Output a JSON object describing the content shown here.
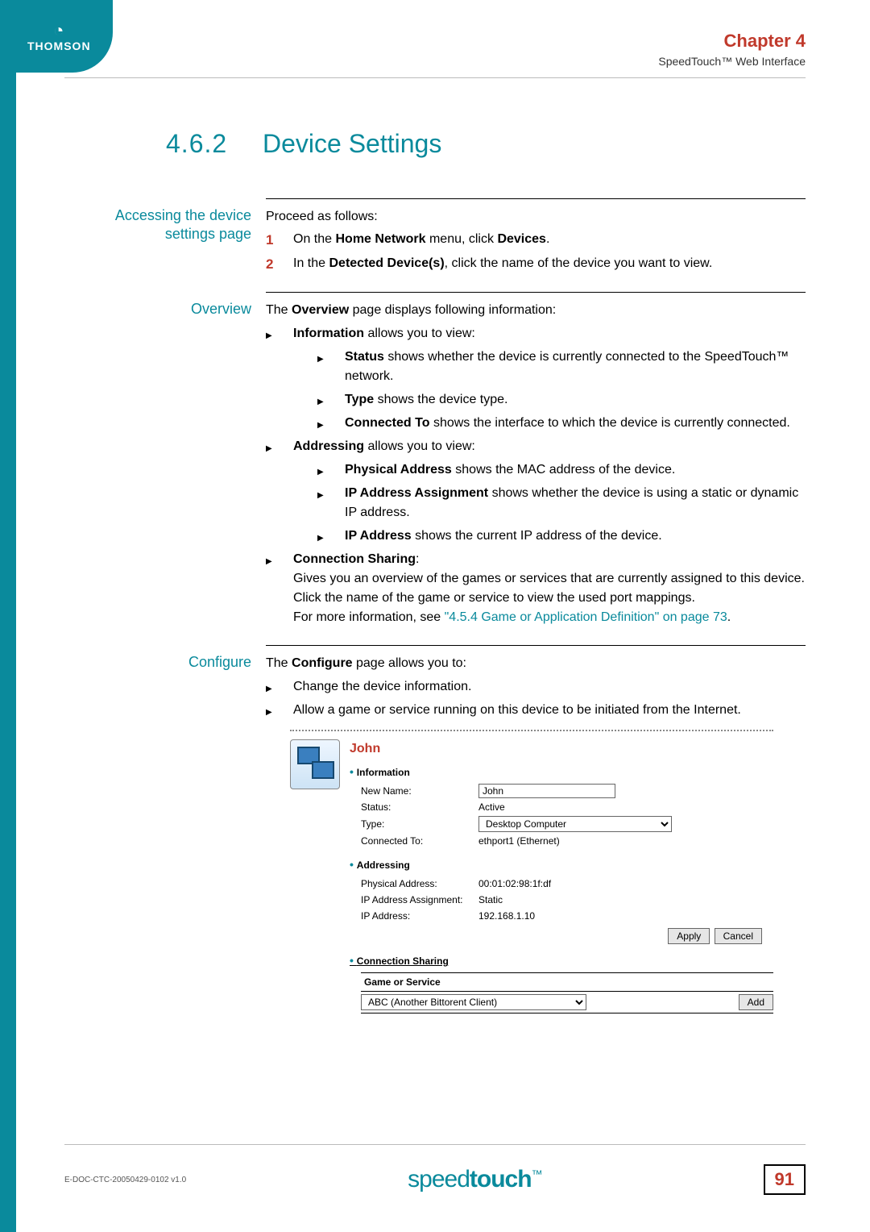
{
  "header": {
    "logo_text": "THOMSON",
    "chapter": "Chapter 4",
    "chapter_sub": "SpeedTouch™ Web Interface"
  },
  "section": {
    "number": "4.6.2",
    "title": "Device Settings"
  },
  "accessing": {
    "label": "Accessing the device settings page",
    "intro": "Proceed as follows:",
    "step1_pre": "On the ",
    "step1_b1": "Home Network",
    "step1_mid": " menu, click ",
    "step1_b2": "Devices",
    "step1_end": ".",
    "step2_pre": "In the ",
    "step2_b": "Detected Device(s)",
    "step2_end": ", click the name of the device you want to view."
  },
  "overview": {
    "label": "Overview",
    "intro_pre": "The ",
    "intro_b": "Overview",
    "intro_end": " page displays following information:",
    "info_b": "Information",
    "info_end": " allows you to view:",
    "status_b": "Status",
    "status_end": " shows whether the device is currently connected to the SpeedTouch™ network.",
    "type_b": "Type",
    "type_end": " shows the device type.",
    "conn_b": "Connected To",
    "conn_end": " shows the interface to which the device is currently connected.",
    "addr_b": "Addressing",
    "addr_end": " allows you to view:",
    "pa_b": "Physical Address",
    "pa_end": " shows the MAC address of the device.",
    "ipa_b": "IP Address Assignment",
    "ipa_end": " shows whether the device is using a static or dynamic IP address.",
    "ip_b": "IP Address",
    "ip_end": " shows the current IP address of the device.",
    "cs_b": "Connection Sharing",
    "cs_colon": ":",
    "cs_body": "Gives you an overview of the games or services that are currently assigned to this device. Click the name of the game or service to view the used port mappings.",
    "cs_more_pre": "For more information, see ",
    "cs_link": "\"4.5.4 Game or Application Definition\" on page 73",
    "cs_more_end": "."
  },
  "configure": {
    "label": "Configure",
    "intro_pre": "The ",
    "intro_b": "Configure",
    "intro_end": " page allows you to:",
    "i1": "Change the device information.",
    "i2": "Allow a game or service running on this device to be initiated from the Internet."
  },
  "figure": {
    "title": "John",
    "sect_info": "Information",
    "new_name_lbl": "New Name:",
    "new_name_val": "John",
    "status_lbl": "Status:",
    "status_val": "Active",
    "type_lbl": "Type:",
    "type_val": "Desktop Computer",
    "conn_lbl": "Connected To:",
    "conn_val": "ethport1 (Ethernet)",
    "sect_addr": "Addressing",
    "pa_lbl": "Physical Address:",
    "pa_val": "00:01:02:98:1f:df",
    "ipa_lbl": "IP Address Assignment:",
    "ipa_val": "Static",
    "ip_lbl": "IP Address:",
    "ip_val": "192.168.1.10",
    "apply": "Apply",
    "cancel": "Cancel",
    "sect_cs": "Connection Sharing",
    "th_game": "Game or Service",
    "game_val": "ABC (Another Bittorent Client)",
    "add": "Add"
  },
  "footer": {
    "docid": "E-DOC-CTC-20050429-0102 v1.0",
    "brand_pre": "speed",
    "brand_b": "touch",
    "brand_tm": "™",
    "page": "91"
  }
}
